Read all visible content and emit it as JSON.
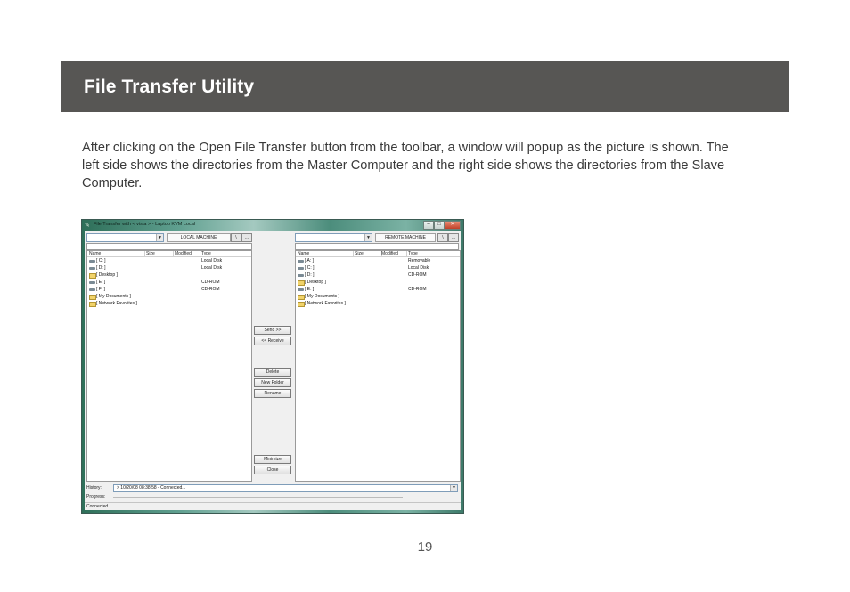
{
  "header": {
    "title": "File Transfer Utility"
  },
  "intro": "After clicking on the Open File Transfer button from the toolbar, a window will popup as the picture is shown. The left side shows the directories from the Master Computer and the right side shows the directories from the Slave Computer.",
  "page_number": "19",
  "window": {
    "title": "File Transfer with < vista > - Laptop KVM Local",
    "minimize_glyph": "–",
    "maximize_glyph": "□",
    "close_glyph": "✕",
    "local": {
      "label": "LOCAL MACHINE",
      "up_button": "\\",
      "extra_button": "...",
      "columns": [
        "Name",
        "Size",
        "Modified",
        "Type"
      ],
      "items": [
        {
          "icon": "drive-icon",
          "name": "[ C: ]",
          "type": "Local Disk"
        },
        {
          "icon": "drive-icon",
          "name": "[ D: ]",
          "type": "Local Disk"
        },
        {
          "icon": "folder-icon",
          "name": "[ Desktop ]",
          "type": ""
        },
        {
          "icon": "drive-icon",
          "name": "[ E: ]",
          "type": "CD-ROM"
        },
        {
          "icon": "drive-icon",
          "name": "[ F: ]",
          "type": "CD-ROM"
        },
        {
          "icon": "folder-icon",
          "name": "[ My Documents ]",
          "type": ""
        },
        {
          "icon": "folder-icon",
          "name": "[ Network Favorites ]",
          "type": ""
        }
      ]
    },
    "remote": {
      "label": "REMOTE MACHINE",
      "up_button": "\\",
      "extra_button": "...",
      "columns": [
        "Name",
        "Size",
        "Modified",
        "Type"
      ],
      "items": [
        {
          "icon": "drive-icon",
          "name": "[ A: ]",
          "type": "Removable"
        },
        {
          "icon": "drive-icon",
          "name": "[ C: ]",
          "type": "Local Disk"
        },
        {
          "icon": "drive-icon",
          "name": "[ D: ]",
          "type": "CD-ROM"
        },
        {
          "icon": "folder-icon",
          "name": "[ Desktop ]",
          "type": ""
        },
        {
          "icon": "drive-icon",
          "name": "[ E: ]",
          "type": "CD-ROM"
        },
        {
          "icon": "folder-icon",
          "name": "[ My Documents ]",
          "type": ""
        },
        {
          "icon": "folder-icon",
          "name": "[ Network Favorites ]",
          "type": ""
        }
      ]
    },
    "buttons": {
      "send": "Send >>",
      "receive": "<< Receive",
      "delete": "Delete",
      "new_folder": "New Folder",
      "rename": "Rename",
      "minimize": "Minimize",
      "close": "Close"
    },
    "history_label": "History:",
    "history_value": "> 10/20/08 08:38:58 - Connected...",
    "progress_label": "Progress:",
    "status": "Connected..."
  }
}
